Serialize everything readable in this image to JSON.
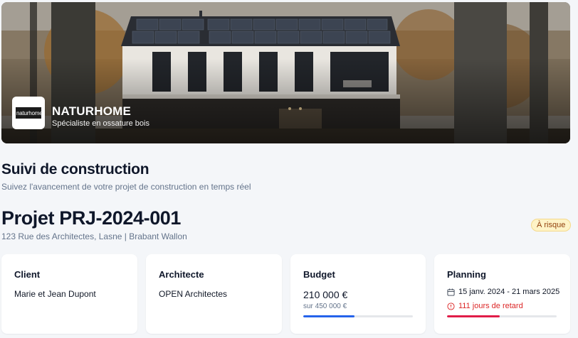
{
  "brand": {
    "logo_text": "naturhome",
    "name": "NATURHOME",
    "tagline": "Spécialiste en ossature bois"
  },
  "header": {
    "title": "Suivi de construction",
    "subtitle": "Suivez l'avancement de votre projet de construction en temps réel"
  },
  "project": {
    "title": "Projet PRJ-2024-001",
    "address": "123 Rue des Architectes, Lasne | Brabant Wallon",
    "status_badge": "À risque"
  },
  "cards": {
    "client": {
      "label": "Client",
      "value": "Marie et Jean Dupont"
    },
    "architect": {
      "label": "Architecte",
      "value": "OPEN Architectes"
    },
    "budget": {
      "label": "Budget",
      "spent": "210 000 €",
      "total": "sur 450 000 €",
      "progress_fraction": 0.47
    },
    "planning": {
      "label": "Planning",
      "dates": "15 janv. 2024 - 21 mars 2025",
      "delay": "111 jours de retard",
      "progress_fraction": 0.48
    }
  },
  "colors": {
    "budget_bar": "#2563eb",
    "planning_bar": "#e11d48",
    "risk_badge_bg": "#fef3c7",
    "risk_badge_text": "#92400e",
    "delay_text": "#dc2626"
  },
  "icons": {
    "calendar": "calendar-icon",
    "alert": "alert-circle-icon"
  }
}
